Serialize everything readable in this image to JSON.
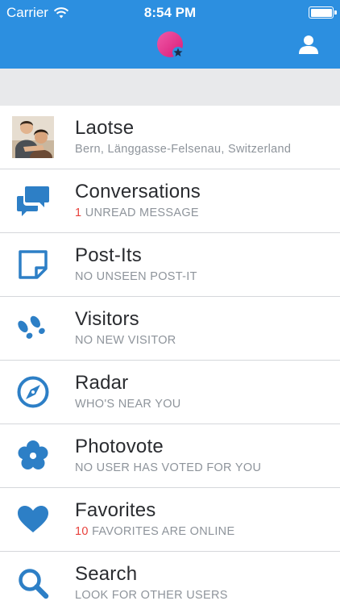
{
  "status_bar": {
    "carrier": "Carrier",
    "time": "8:54 PM"
  },
  "colors": {
    "nav_bar": "#2c8fe0",
    "icon": "#2d7fc6",
    "count_highlight": "#e8413c",
    "subtitle": "#8e949b"
  },
  "nav": {
    "logo_icon": "app-logo-star",
    "profile_icon": "user-silhouette"
  },
  "profile": {
    "name": "Laotse",
    "location": "Bern, Länggasse-Felsenau, Switzerland"
  },
  "menu": [
    {
      "label": "Conversations",
      "count": "1",
      "status": " UNREAD MESSAGE",
      "icon": "chat-bubbles"
    },
    {
      "label": "Post-Its",
      "count": "",
      "status": "NO UNSEEN POST-IT",
      "icon": "sticky-note"
    },
    {
      "label": "Visitors",
      "count": "",
      "status": "NO NEW VISITOR",
      "icon": "footprints"
    },
    {
      "label": "Radar",
      "count": "",
      "status": "WHO'S NEAR YOU",
      "icon": "compass"
    },
    {
      "label": "Photovote",
      "count": "",
      "status": "NO USER HAS VOTED FOR YOU",
      "icon": "flower"
    },
    {
      "label": "Favorites",
      "count": "10",
      "status": " FAVORITES ARE ONLINE",
      "icon": "heart"
    },
    {
      "label": "Search",
      "count": "",
      "status": "LOOK FOR OTHER USERS",
      "icon": "magnifier"
    }
  ]
}
